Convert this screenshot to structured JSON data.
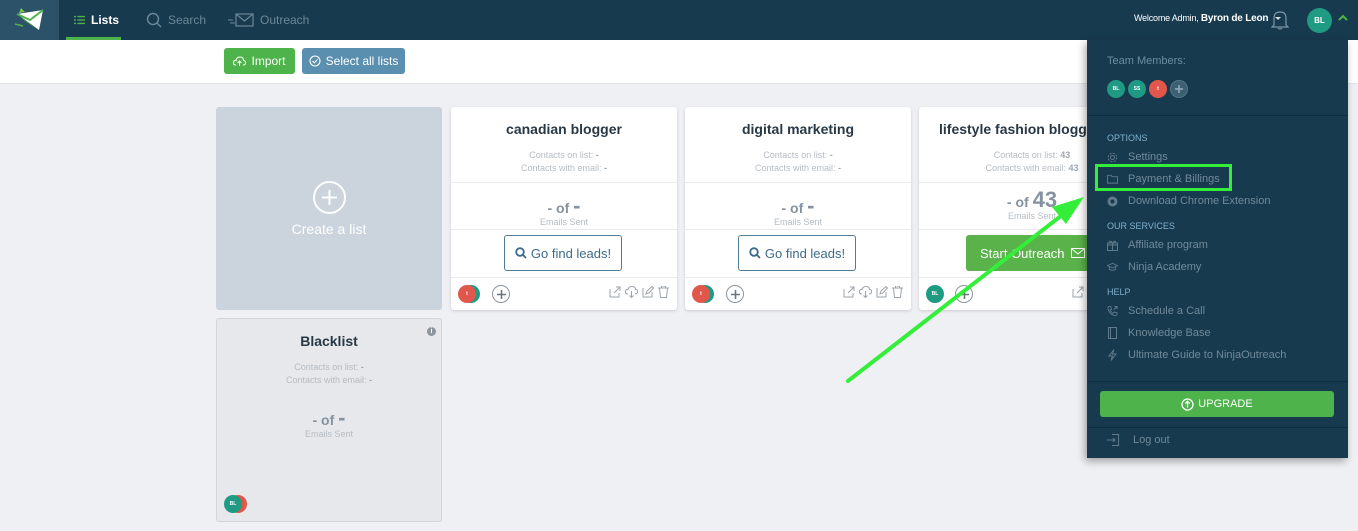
{
  "nav": {
    "items": [
      {
        "label": "Lists",
        "icon": "list-icon",
        "active": true
      },
      {
        "label": "Search",
        "icon": "search-icon",
        "active": false
      },
      {
        "label": "Outreach",
        "icon": "envelope-fast-icon",
        "active": false
      }
    ],
    "welcome_prefix": "Welcome Admin,",
    "user_name": "Byron de Leon",
    "user_initials": "BL"
  },
  "toolbar": {
    "import_label": "Import",
    "select_all_label": "Select all lists"
  },
  "create_card": {
    "label": "Create a list"
  },
  "lists": [
    {
      "title": "canadian blogger",
      "contacts_label": "Contacts on list:",
      "contacts_value": "-",
      "email_label": "Contacts with email:",
      "email_value": "-",
      "sent_prefix": "- of",
      "sent_total": "-",
      "sent_label": "Emails Sent",
      "action_label": "Go find leads!",
      "member_initial": "t"
    },
    {
      "title": "digital marketing",
      "contacts_label": "Contacts on list:",
      "contacts_value": "-",
      "email_label": "Contacts with email:",
      "email_value": "-",
      "sent_prefix": "- of",
      "sent_total": "-",
      "sent_label": "Emails Sent",
      "action_label": "Go find leads!",
      "member_initial": "t"
    },
    {
      "title": "lifestyle fashion blogger",
      "contacts_label": "Contacts on list:",
      "contacts_value": "43",
      "email_label": "Contacts with email:",
      "email_value": "43",
      "sent_prefix": "- of",
      "sent_total": "43",
      "sent_label": "Emails Sent",
      "action_label": "Start Outreach",
      "member_initial": "BL"
    }
  ],
  "blacklist": {
    "title": "Blacklist",
    "contacts_label": "Contacts on list:",
    "contacts_value": "-",
    "email_label": "Contacts with email:",
    "email_value": "-",
    "sent_prefix": "- of",
    "sent_total": "-",
    "sent_label": "Emails Sent",
    "member_initial": "BL"
  },
  "dropdown": {
    "team_heading": "Team Members:",
    "team": [
      {
        "initials": "BL",
        "color": "#1f9a83"
      },
      {
        "initials": "SS",
        "color": "#1f9a83"
      },
      {
        "initials": "t",
        "color": "#e2574c"
      }
    ],
    "options_heading": "OPTIONS",
    "options": [
      {
        "label": "Settings",
        "icon": "gear-icon"
      },
      {
        "label": "Payment & Billings",
        "icon": "folder-icon"
      },
      {
        "label": "Download Chrome Extension",
        "icon": "chrome-icon"
      }
    ],
    "services_heading": "OUR SERVICES",
    "services": [
      {
        "label": "Affiliate program",
        "icon": "gift-icon"
      },
      {
        "label": "Ninja Academy",
        "icon": "graduation-cap-icon"
      }
    ],
    "help_heading": "HELP",
    "help": [
      {
        "label": "Schedule a Call",
        "icon": "phone-icon"
      },
      {
        "label": "Knowledge Base",
        "icon": "book-icon"
      },
      {
        "label": "Ultimate Guide to NinjaOutreach",
        "icon": "bolt-icon"
      }
    ],
    "upgrade_label": "UPGRADE",
    "logout_label": "Log out"
  },
  "colors": {
    "nav_bg": "#183a4f",
    "accent_green": "#4db34a",
    "select_blue": "#5a8fb0",
    "annotation_green": "#34ee3a"
  }
}
